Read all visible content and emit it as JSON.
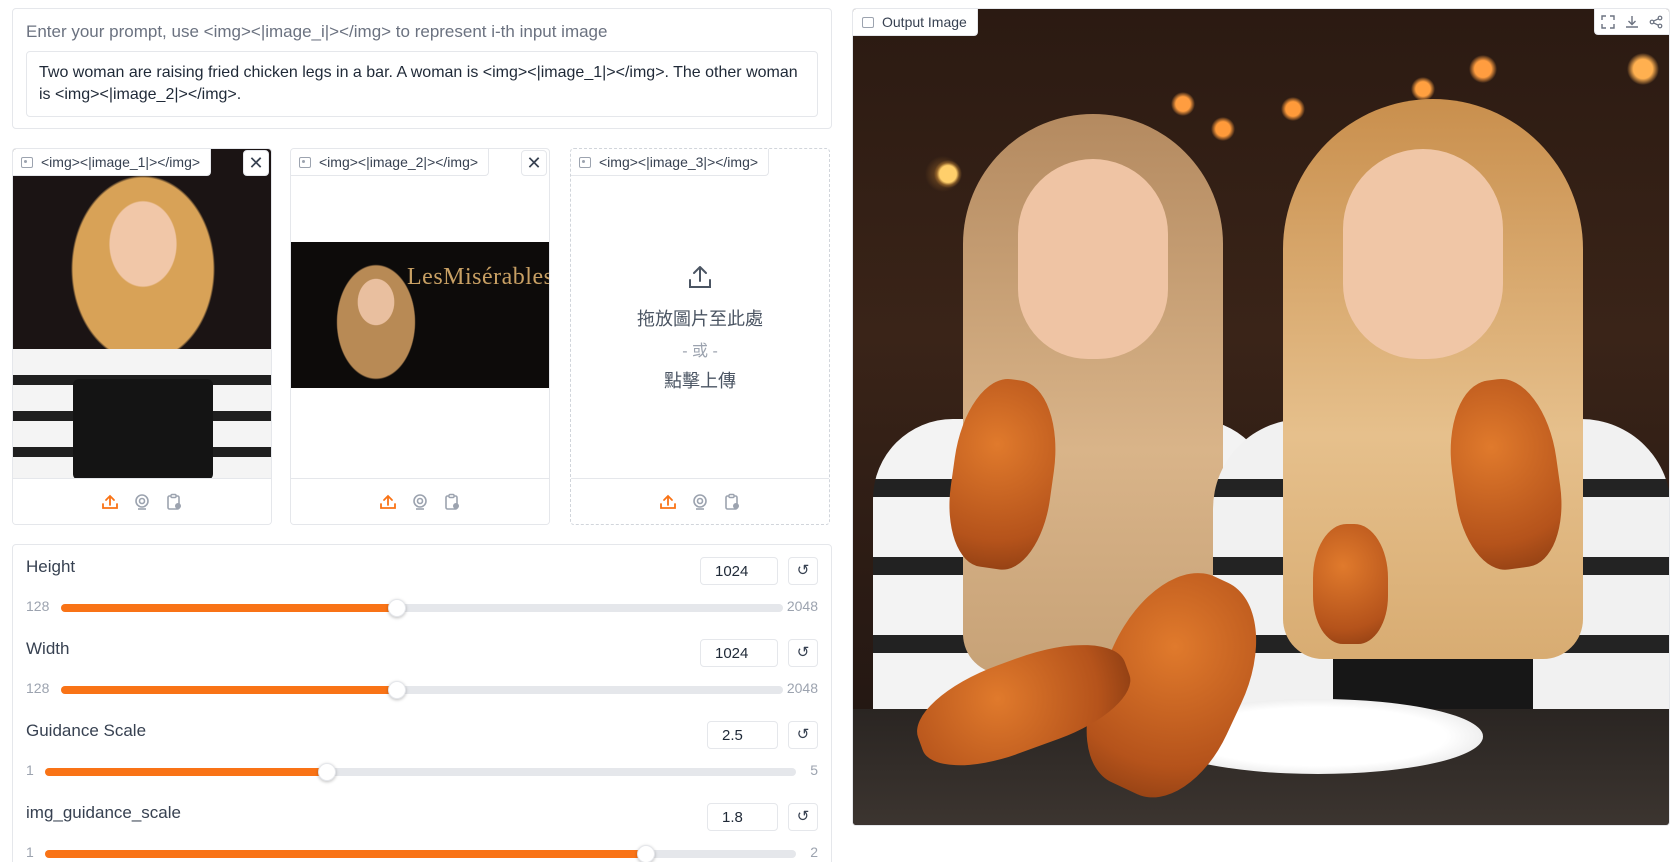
{
  "prompt": {
    "label": "Enter your prompt, use <img><|image_i|></img> to represent i-th input image",
    "value": "Two woman are raising fried chicken legs in a bar. A woman is <img><|image_1|></img>. The other woman is <img><|image_2|></img>."
  },
  "images": [
    {
      "label": "<img><|image_1|></img>",
      "close": "✕",
      "has_image": true
    },
    {
      "label": "<img><|image_2|></img>",
      "close": "✕",
      "has_image": true,
      "overlay_text": "LesMisérables"
    },
    {
      "label": "<img><|image_3|></img>",
      "has_image": false,
      "drop": {
        "line1": "拖放圖片至此處",
        "line2": "- 或 -",
        "line3": "點擊上傳"
      }
    }
  ],
  "toolbar_icons": [
    "upload-icon",
    "webcam-icon",
    "clipboard-icon"
  ],
  "sliders": [
    {
      "name": "Height",
      "value": "1024",
      "min": "128",
      "max": "2048",
      "fraction": 0.4652
    },
    {
      "name": "Width",
      "value": "1024",
      "min": "128",
      "max": "2048",
      "fraction": 0.4652
    },
    {
      "name": "Guidance Scale",
      "value": "2.5",
      "min": "1",
      "max": "5",
      "fraction": 0.375
    },
    {
      "name": "img_guidance_scale",
      "value": "1.8",
      "min": "1",
      "max": "2",
      "fraction": 0.8
    }
  ],
  "reset_glyph": "↺",
  "output": {
    "label": "Output Image",
    "actions": [
      "fullscreen-icon",
      "download-icon",
      "share-icon"
    ]
  },
  "colors": {
    "accent": "#f97316",
    "track": "#e5e7eb",
    "border": "#e5e7eb"
  }
}
